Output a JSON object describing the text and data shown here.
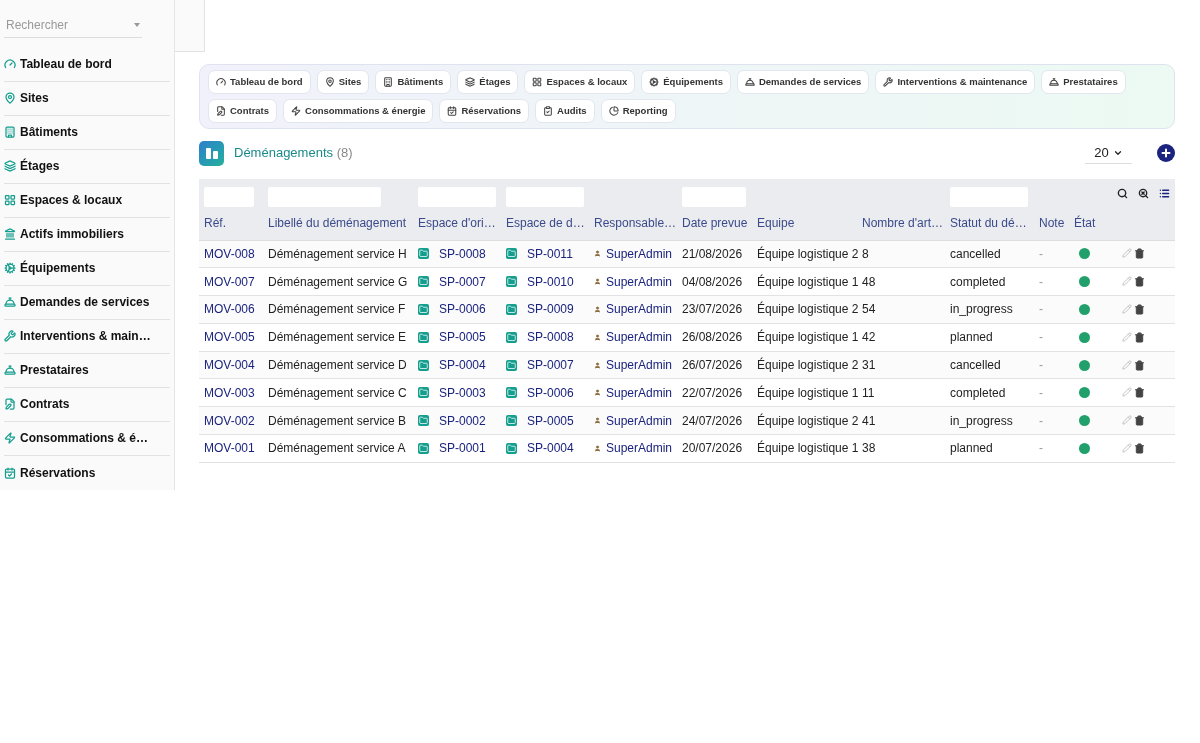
{
  "sidebar": {
    "search": {
      "placeholder": "Rechercher"
    },
    "items": [
      {
        "label": "Tableau de bord"
      },
      {
        "label": "Sites"
      },
      {
        "label": "Bâtiments"
      },
      {
        "label": "Étages"
      },
      {
        "label": "Espaces & locaux"
      },
      {
        "label": "Actifs immobiliers"
      },
      {
        "label": "Équipements"
      },
      {
        "label": "Demandes de services"
      },
      {
        "label": "Interventions & main…"
      },
      {
        "label": "Prestataires"
      },
      {
        "label": "Contrats"
      },
      {
        "label": "Consommations & é…"
      },
      {
        "label": "Réservations"
      }
    ]
  },
  "quick_links": [
    {
      "label": "Tableau de bord"
    },
    {
      "label": "Sites"
    },
    {
      "label": "Bâtiments"
    },
    {
      "label": "Étages"
    },
    {
      "label": "Espaces & locaux"
    },
    {
      "label": "Équipements"
    },
    {
      "label": "Demandes de services"
    },
    {
      "label": "Interventions & maintenance"
    },
    {
      "label": "Prestataires"
    },
    {
      "label": "Contrats"
    },
    {
      "label": "Consommations & énergie"
    },
    {
      "label": "Réservations"
    },
    {
      "label": "Audits"
    },
    {
      "label": "Reporting"
    }
  ],
  "list": {
    "title": "Déménagements",
    "count": "(8)",
    "page_size": "20",
    "columns": [
      {
        "label": "Réf.",
        "filter": true
      },
      {
        "label": "Libellé du déménagement",
        "filter": true
      },
      {
        "label": "Espace d'ori…",
        "filter": true
      },
      {
        "label": "Espace de d…",
        "filter": true
      },
      {
        "label": "Responsable…",
        "filter": false
      },
      {
        "label": "Date prevue",
        "filter": true
      },
      {
        "label": "Equipe",
        "filter": false
      },
      {
        "label": "Nombre d'art…",
        "filter": false
      },
      {
        "label": "Statut du dé…",
        "filter": true
      },
      {
        "label": "Note",
        "filter": false
      },
      {
        "label": "État",
        "filter": false
      }
    ],
    "rows": [
      {
        "ref": "MOV-008",
        "label": "Déménagement service H",
        "origin": "SP-0008",
        "destination": "SP-0011",
        "owner": "SuperAdmin",
        "date": "21/08/2026",
        "team": "Équipe logistique 2",
        "items": "8",
        "status": "cancelled",
        "note": "-",
        "active": true
      },
      {
        "ref": "MOV-007",
        "label": "Déménagement service G",
        "origin": "SP-0007",
        "destination": "SP-0010",
        "owner": "SuperAdmin",
        "date": "04/08/2026",
        "team": "Équipe logistique 1",
        "items": "48",
        "status": "completed",
        "note": "-",
        "active": true
      },
      {
        "ref": "MOV-006",
        "label": "Déménagement service F",
        "origin": "SP-0006",
        "destination": "SP-0009",
        "owner": "SuperAdmin",
        "date": "23/07/2026",
        "team": "Équipe logistique 2",
        "items": "54",
        "status": "in_progress",
        "note": "-",
        "active": true
      },
      {
        "ref": "MOV-005",
        "label": "Déménagement service E",
        "origin": "SP-0005",
        "destination": "SP-0008",
        "owner": "SuperAdmin",
        "date": "26/08/2026",
        "team": "Équipe logistique 1",
        "items": "42",
        "status": "planned",
        "note": "-",
        "active": true
      },
      {
        "ref": "MOV-004",
        "label": "Déménagement service D",
        "origin": "SP-0004",
        "destination": "SP-0007",
        "owner": "SuperAdmin",
        "date": "26/07/2026",
        "team": "Équipe logistique 2",
        "items": "31",
        "status": "cancelled",
        "note": "-",
        "active": true
      },
      {
        "ref": "MOV-003",
        "label": "Déménagement service C",
        "origin": "SP-0003",
        "destination": "SP-0006",
        "owner": "SuperAdmin",
        "date": "22/07/2026",
        "team": "Équipe logistique 1",
        "items": "11",
        "status": "completed",
        "note": "-",
        "active": true
      },
      {
        "ref": "MOV-002",
        "label": "Déménagement service B",
        "origin": "SP-0002",
        "destination": "SP-0005",
        "owner": "SuperAdmin",
        "date": "24/07/2026",
        "team": "Équipe logistique 2",
        "items": "41",
        "status": "in_progress",
        "note": "-",
        "active": true
      },
      {
        "ref": "MOV-001",
        "label": "Déménagement service A",
        "origin": "SP-0001",
        "destination": "SP-0004",
        "owner": "SuperAdmin",
        "date": "20/07/2026",
        "team": "Équipe logistique 1",
        "items": "38",
        "status": "planned",
        "note": "-",
        "active": true
      }
    ]
  }
}
